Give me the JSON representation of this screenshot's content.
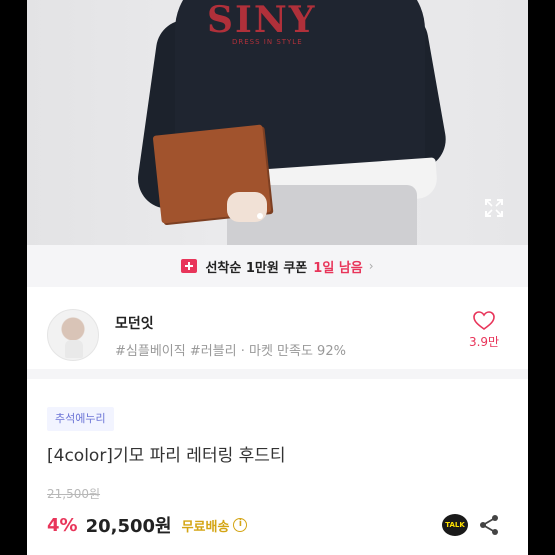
{
  "hero": {
    "print_big": "SINY",
    "print_small": "DRESS IN STYLE"
  },
  "coupon": {
    "prefix": "선착순 1만원 쿠폰",
    "remaining": "1일 남음",
    "chevron": "›"
  },
  "store": {
    "name": "모던잇",
    "tags": "#심플베이직 #러블리 · 마켓 만족도 92%",
    "likes": "3.9만"
  },
  "product": {
    "tag": "추석에누리",
    "title": "[4color]기모 파리 레터링 후드티",
    "original_price": "21,500원",
    "discount": "4%",
    "price": "20,500원",
    "shipping": "무료배송",
    "info_glyph": "i"
  },
  "actions": {
    "talk_label": "TALK"
  },
  "colors": {
    "accent": "#e8355a",
    "shipping": "#d4a514",
    "tag_text": "#6b74d6"
  }
}
